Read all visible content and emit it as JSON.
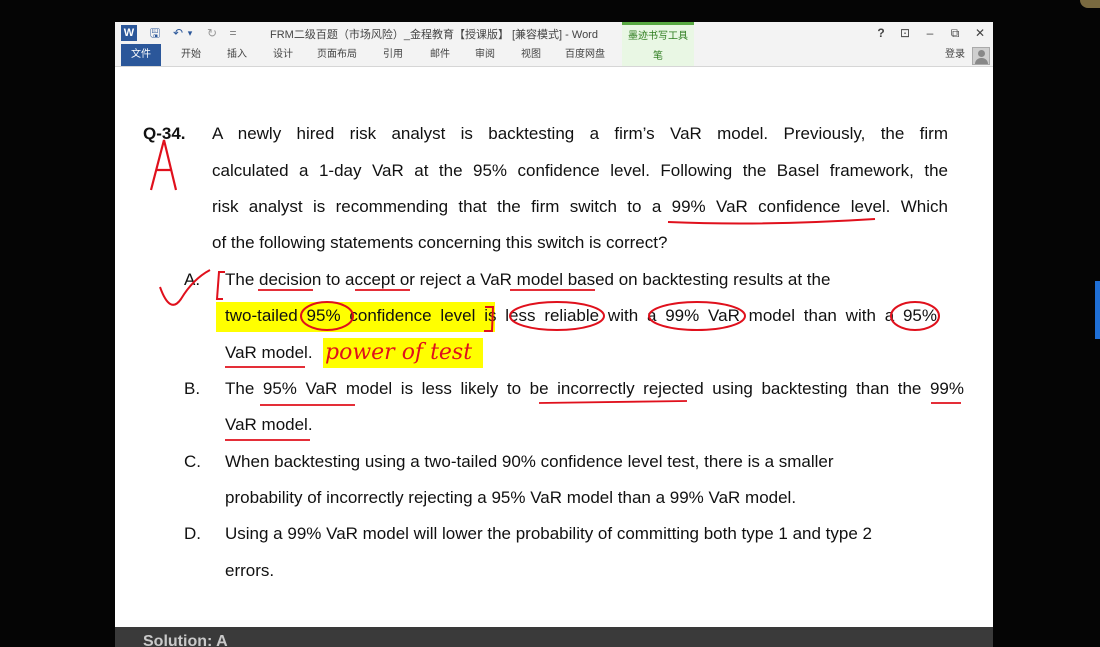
{
  "title_bar": {
    "title": "FRM二级百题（市场风险）_金程教育【授课版】 [兼容模式] - Word",
    "help": "?",
    "ribbon_display": "⊡",
    "minimize": "–",
    "restore": "⧉",
    "close": "✕"
  },
  "quick_access": {
    "word_icon": "W",
    "save": "🖫",
    "undo": "↶",
    "undo_more": "▾",
    "redo": "↻",
    "customize": "="
  },
  "ink_tools": {
    "group_label": "墨迹书写工具",
    "tab_label": "笔"
  },
  "ribbon": {
    "tabs": [
      "文件",
      "开始",
      "插入",
      "设计",
      "页面布局",
      "引用",
      "邮件",
      "审阅",
      "视图",
      "百度网盘"
    ],
    "login": "登录"
  },
  "question": {
    "number": "Q-34.",
    "stem": [
      "A newly hired risk analyst is backtesting a firm’s VaR model. Previously, the firm",
      "calculated a 1-day VaR at the 95% confidence level. Following the Basel framework, the",
      "risk analyst is recommending that the firm switch to a 99% VaR confidence level. Which",
      "of the following statements concerning this switch is correct?"
    ],
    "options": [
      {
        "letter": "A.",
        "lines": [
          "The decision to accept or reject a VaR model based on backtesting results at the",
          "two-tailed 95% confidence level is less reliable with a 99% VaR model than with a 95%",
          "VaR model."
        ]
      },
      {
        "letter": "B.",
        "lines": [
          "The 95% VaR model is less likely to be incorrectly rejected using backtesting than the 99%",
          "VaR model."
        ]
      },
      {
        "letter": "C.",
        "lines": [
          "When backtesting using a two-tailed 90% confidence level test, there is a smaller",
          "probability of incorrectly rejecting a 95% VaR model than a 99% VaR model."
        ]
      },
      {
        "letter": "D.",
        "lines": [
          "Using a 99% VaR model will lower the probability of committing both type 1 and type 2",
          "errors."
        ]
      }
    ]
  },
  "annotations": {
    "answer_mark": "A",
    "handwritten_note": "power of test"
  },
  "solution_label": "Solution: A",
  "colors": {
    "ink_red": "#e0101c",
    "highlight": "#ffff00",
    "word_blue": "#2b579a"
  }
}
